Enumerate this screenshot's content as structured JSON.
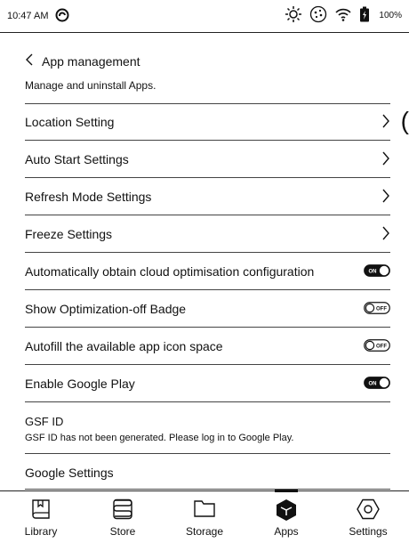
{
  "status": {
    "time": "10:47 AM",
    "battery": "100%"
  },
  "header": {
    "title": "App management",
    "subtitle": "Manage and uninstall Apps."
  },
  "settings": [
    {
      "label": "Location Setting",
      "control": "chevron"
    },
    {
      "label": "Auto Start Settings",
      "control": "chevron"
    },
    {
      "label": "Refresh Mode Settings",
      "control": "chevron"
    },
    {
      "label": "Freeze Settings",
      "control": "chevron"
    },
    {
      "label": "Automatically obtain cloud optimisation configuration",
      "control": "toggle",
      "state": "ON"
    },
    {
      "label": "Show Optimization-off Badge",
      "control": "toggle",
      "state": "OFF"
    },
    {
      "label": "Autofill the available app icon space",
      "control": "toggle",
      "state": "OFF"
    },
    {
      "label": "Enable Google Play",
      "control": "toggle",
      "state": "ON"
    }
  ],
  "gsf": {
    "title": "GSF ID",
    "description": "GSF ID has not been generated. Please log in to Google Play."
  },
  "google_settings": "Google Settings",
  "nav": [
    {
      "label": "Library",
      "icon": "book-icon"
    },
    {
      "label": "Store",
      "icon": "store-icon"
    },
    {
      "label": "Storage",
      "icon": "folder-icon"
    },
    {
      "label": "Apps",
      "icon": "apps-cube-icon",
      "active": true
    },
    {
      "label": "Settings",
      "icon": "settings-hexagon-icon"
    }
  ]
}
